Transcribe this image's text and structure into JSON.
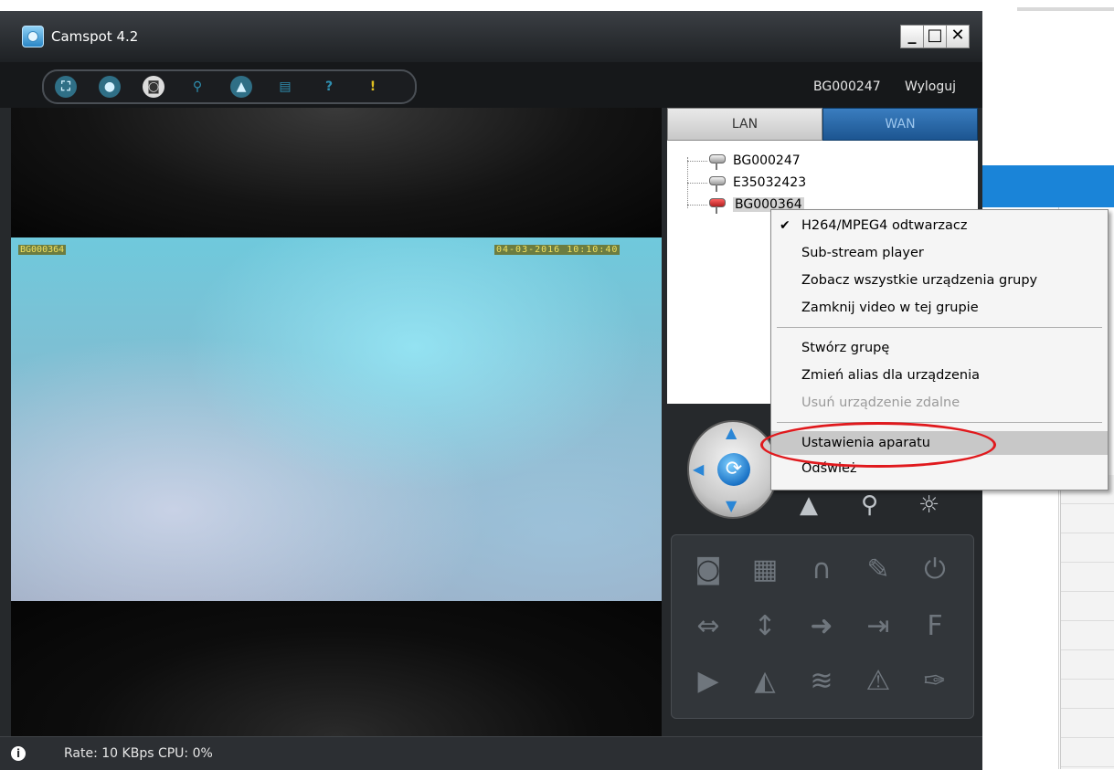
{
  "window": {
    "title": "Camspot 4.2",
    "min_label": "_",
    "max_label": "□",
    "close_label": "✕"
  },
  "toolbar": {
    "icons": [
      "fullscreen-icon",
      "record-icon",
      "snapshot-icon",
      "search-icon",
      "lock-icon",
      "storage-icon",
      "help-icon",
      "info-icon"
    ],
    "user": "BG000247",
    "logout_label": "Wyloguj"
  },
  "video": {
    "osd_id": "BG000364",
    "osd_timestamp": "04-03-2016 10:10:40"
  },
  "tabs": {
    "lan": "LAN",
    "wan": "WAN"
  },
  "device_tree": {
    "items": [
      {
        "label": "BG000247",
        "status": "online"
      },
      {
        "label": "E35032423",
        "status": "online"
      },
      {
        "label": "BG000364",
        "status": "alert",
        "selected": true
      }
    ]
  },
  "context_menu": {
    "items": [
      {
        "label": "H264/MPEG4 odtwarzacz",
        "checked": true
      },
      {
        "label": "Sub-stream player"
      },
      {
        "label": "Zobacz wszystkie urządzenia grupy"
      },
      {
        "label": "Zamknij video w tej grupie"
      },
      {
        "label": "Stwórz grupę"
      },
      {
        "label": "Zmień alias dla urządzenia"
      },
      {
        "label": "Usuń urządzenie zdalne",
        "disabled": true
      },
      {
        "label": "Ustawienia aparatu",
        "highlighted": true
      },
      {
        "label": "Odśwież"
      }
    ],
    "annotation_color": "#e0191d"
  },
  "controls": {
    "ptz_extra": [
      "triangle-icon",
      "zoom-icon",
      "brightness-icon"
    ],
    "grid": [
      "camera-icon",
      "clapper-icon",
      "headphones-icon",
      "microphone-icon",
      "power-icon",
      "horizontal-arrows-icon",
      "vertical-arrows-icon",
      "arrow-right-icon",
      "enter-icon",
      "f-icon",
      "play-icon",
      "split-icon",
      "wifi-icon",
      "warning-icon",
      "wrench-icon"
    ]
  },
  "status": {
    "text": "Rate: 10 KBps  CPU:   0%"
  },
  "colors": {
    "window_bg": "#26292c",
    "wan_tab": "#1c5591",
    "selection": "#d4d4d4",
    "desktop_blue": "#1a84d8"
  }
}
